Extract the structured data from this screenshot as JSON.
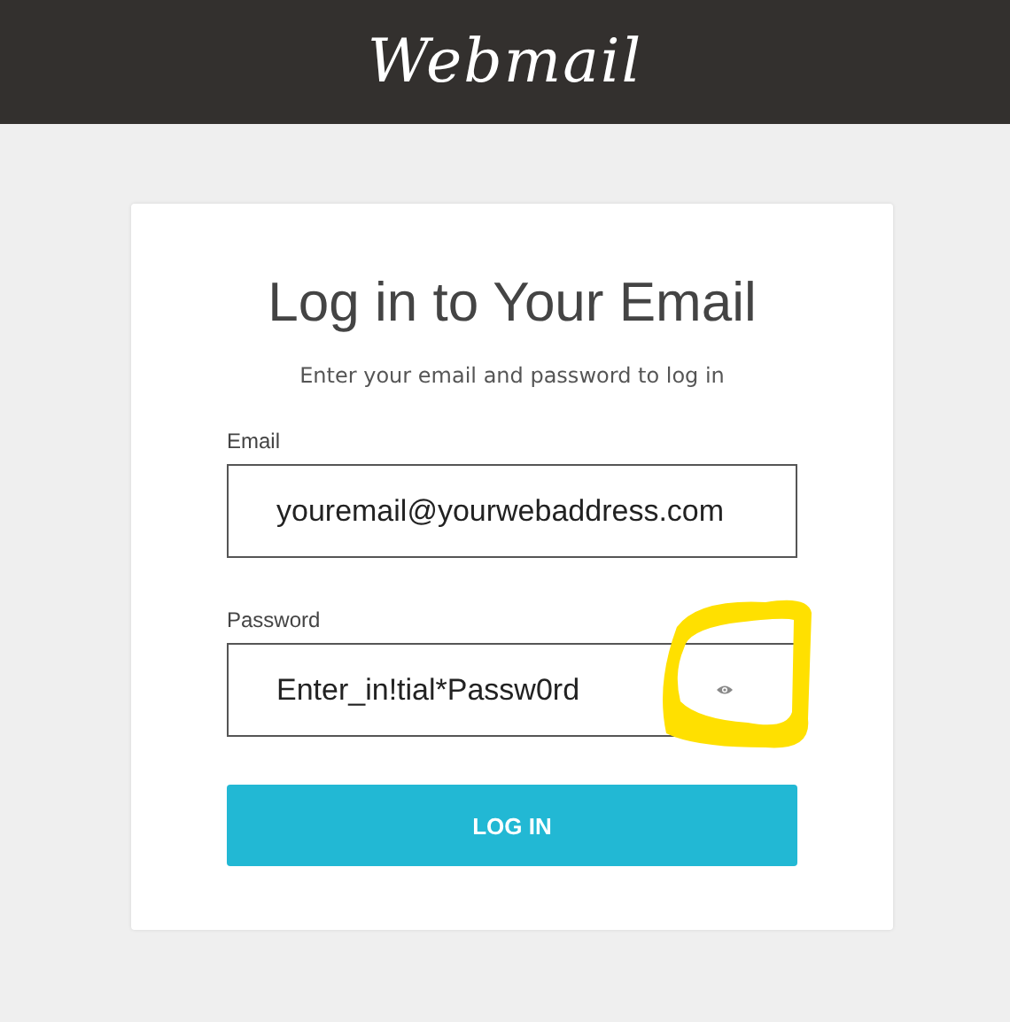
{
  "header": {
    "logo": "Webmail"
  },
  "login": {
    "title": "Log in to Your Email",
    "subtitle": "Enter your email and password to log in",
    "fields": [
      {
        "label": "Email",
        "value": "youremail@yourwebaddress.com",
        "kind": "text"
      },
      {
        "label": "Password",
        "value": "Enter_in!tial*Passw0rd",
        "kind": "password",
        "highlighted": true
      }
    ],
    "button": "LOG IN"
  }
}
